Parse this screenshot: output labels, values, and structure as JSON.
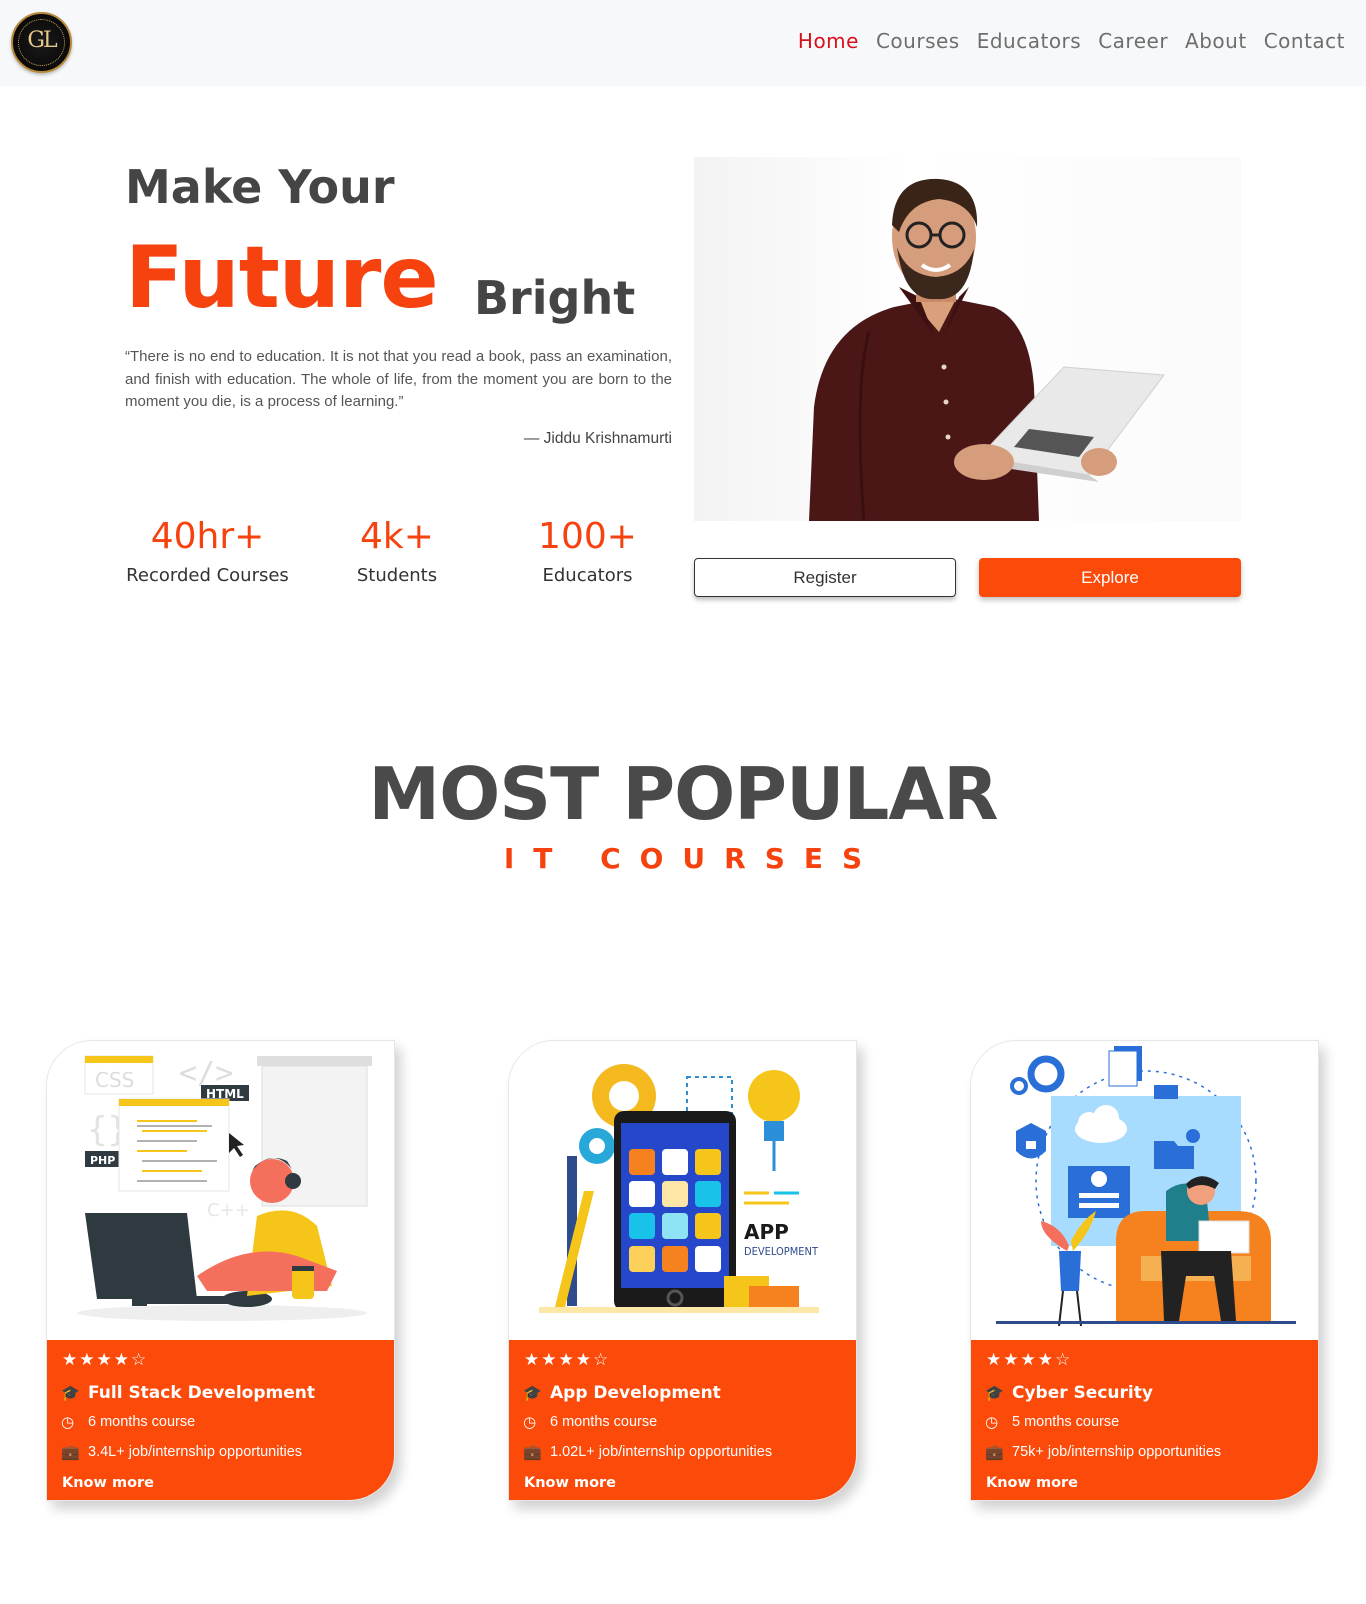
{
  "brand": {
    "logo_text": "GL",
    "logo_ring_text": "GROWLEARN"
  },
  "nav": {
    "items": [
      {
        "label": "Home",
        "active": true
      },
      {
        "label": "Courses"
      },
      {
        "label": "Educators"
      },
      {
        "label": "Career"
      },
      {
        "label": "About"
      },
      {
        "label": "Contact"
      }
    ]
  },
  "hero": {
    "line1": "Make Your",
    "highlight": "Future",
    "line2": "Bright",
    "quote": "“There is no end to education. It is not that you read a book, pass an examination, and finish with education. The whole of life, from the moment you are born to the moment you die, is a process of learning.”",
    "quote_author": "— Jiddu Krishnamurti",
    "stats": [
      {
        "value": "40hr+",
        "label": "Recorded Courses"
      },
      {
        "value": "4k+",
        "label": "Students"
      },
      {
        "value": "100+",
        "label": "Educators"
      }
    ],
    "register_label": "Register",
    "explore_label": "Explore"
  },
  "section": {
    "title": "MOST POPULAR",
    "subtitle": "IT COURSES"
  },
  "courses": [
    {
      "stars": "★★★★☆",
      "rating": 4,
      "title": "Full Stack Development",
      "duration": "6 months course",
      "opportunities": "3.4L+ job/internship opportunities",
      "more": "Know more",
      "image_labels": [
        "CSS",
        "HTML",
        "PHP",
        "C++"
      ]
    },
    {
      "stars": "★★★★☆",
      "rating": 4,
      "title": "App Development",
      "duration": "6 months course",
      "opportunities": "1.02L+ job/internship opportunities",
      "more": "Know more",
      "image_labels": [
        "APP",
        "DEVELOPMENT"
      ]
    },
    {
      "stars": "★★★★☆",
      "rating": 4,
      "title": "Cyber Security",
      "duration": "5 months course",
      "opportunities": "75k+ job/internship opportunities",
      "more": "Know more"
    }
  ],
  "colors": {
    "accent": "#fb4a09",
    "nav_active": "#d9111c",
    "heading": "#454545"
  },
  "icons": [
    "graduation-cap-icon",
    "clock-icon",
    "briefcase-icon",
    "star-icon"
  ]
}
